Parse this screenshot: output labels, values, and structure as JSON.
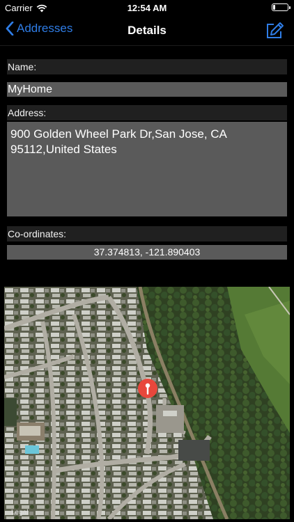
{
  "status_bar": {
    "carrier": "Carrier",
    "time": "12:54 AM",
    "battery_level": 0.15
  },
  "nav": {
    "back_label": "Addresses",
    "title": "Details"
  },
  "form": {
    "name_label": "Name:",
    "name_value": "MyHome",
    "address_label": "Address:",
    "address_value": "900 Golden Wheel Park Dr,San Jose, CA 95112,United States",
    "coords_label": "Co-ordinates:",
    "coords_value": "37.374813, -121.890403"
  },
  "map": {
    "legal_label": "Legal",
    "pin_color": "#e8473c"
  },
  "colors": {
    "accent": "#2f7de6",
    "field_bg": "#5a5a5a",
    "label_bg": "#202020"
  },
  "icons": {
    "back": "chevron-left-icon",
    "compose": "compose-icon",
    "wifi": "wifi-icon",
    "pin": "map-pin-icon"
  }
}
